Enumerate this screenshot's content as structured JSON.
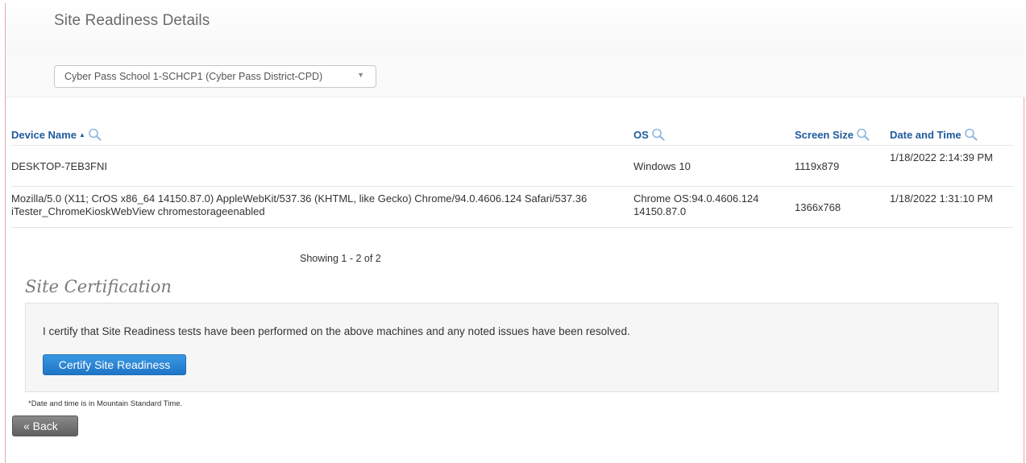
{
  "page": {
    "title": "Site Readiness Details"
  },
  "school_select": {
    "value": "Cyber Pass School 1-SCHCP1 (Cyber Pass District-CPD)",
    "caret_icon": "chevron-down-icon"
  },
  "table": {
    "columns": [
      {
        "key": "device",
        "label": "Device Name",
        "sorted": "ascending",
        "filter_icon": "search-icon"
      },
      {
        "key": "os",
        "label": "OS",
        "filter_icon": "search-icon"
      },
      {
        "key": "screen",
        "label": "Screen Size",
        "filter_icon": "search-icon"
      },
      {
        "key": "datetime",
        "label": "Date and Time",
        "filter_icon": "search-icon"
      }
    ],
    "rows": [
      {
        "device": "DESKTOP-7EB3FNI",
        "os": "Windows 10",
        "screen": "1119x879",
        "datetime": "1/18/2022 2:14:39 PM"
      },
      {
        "device": "Mozilla/5.0 (X11; CrOS x86_64 14150.87.0) AppleWebKit/537.36 (KHTML, like Gecko) Chrome/94.0.4606.124 Safari/537.36 iTester_ChromeKioskWebView chromestorageenabled",
        "os": "Chrome OS:94.0.4606.124 14150.87.0",
        "screen": "1366x768",
        "datetime": "1/18/2022 1:31:10 PM"
      }
    ],
    "showing": "Showing 1 - 2 of 2"
  },
  "certification": {
    "title": "Site Certification",
    "statement": "I certify that Site Readiness tests have been performed on the above machines and any noted issues have been resolved.",
    "button_label": "Certify Site Readiness"
  },
  "footnote": "*Date and time is in Mountain Standard Time.",
  "back_label": "« Back",
  "colors": {
    "link_blue": "#1e5a9c",
    "button_blue": "#1f74c6",
    "back_gray": "#6e6e6e"
  }
}
